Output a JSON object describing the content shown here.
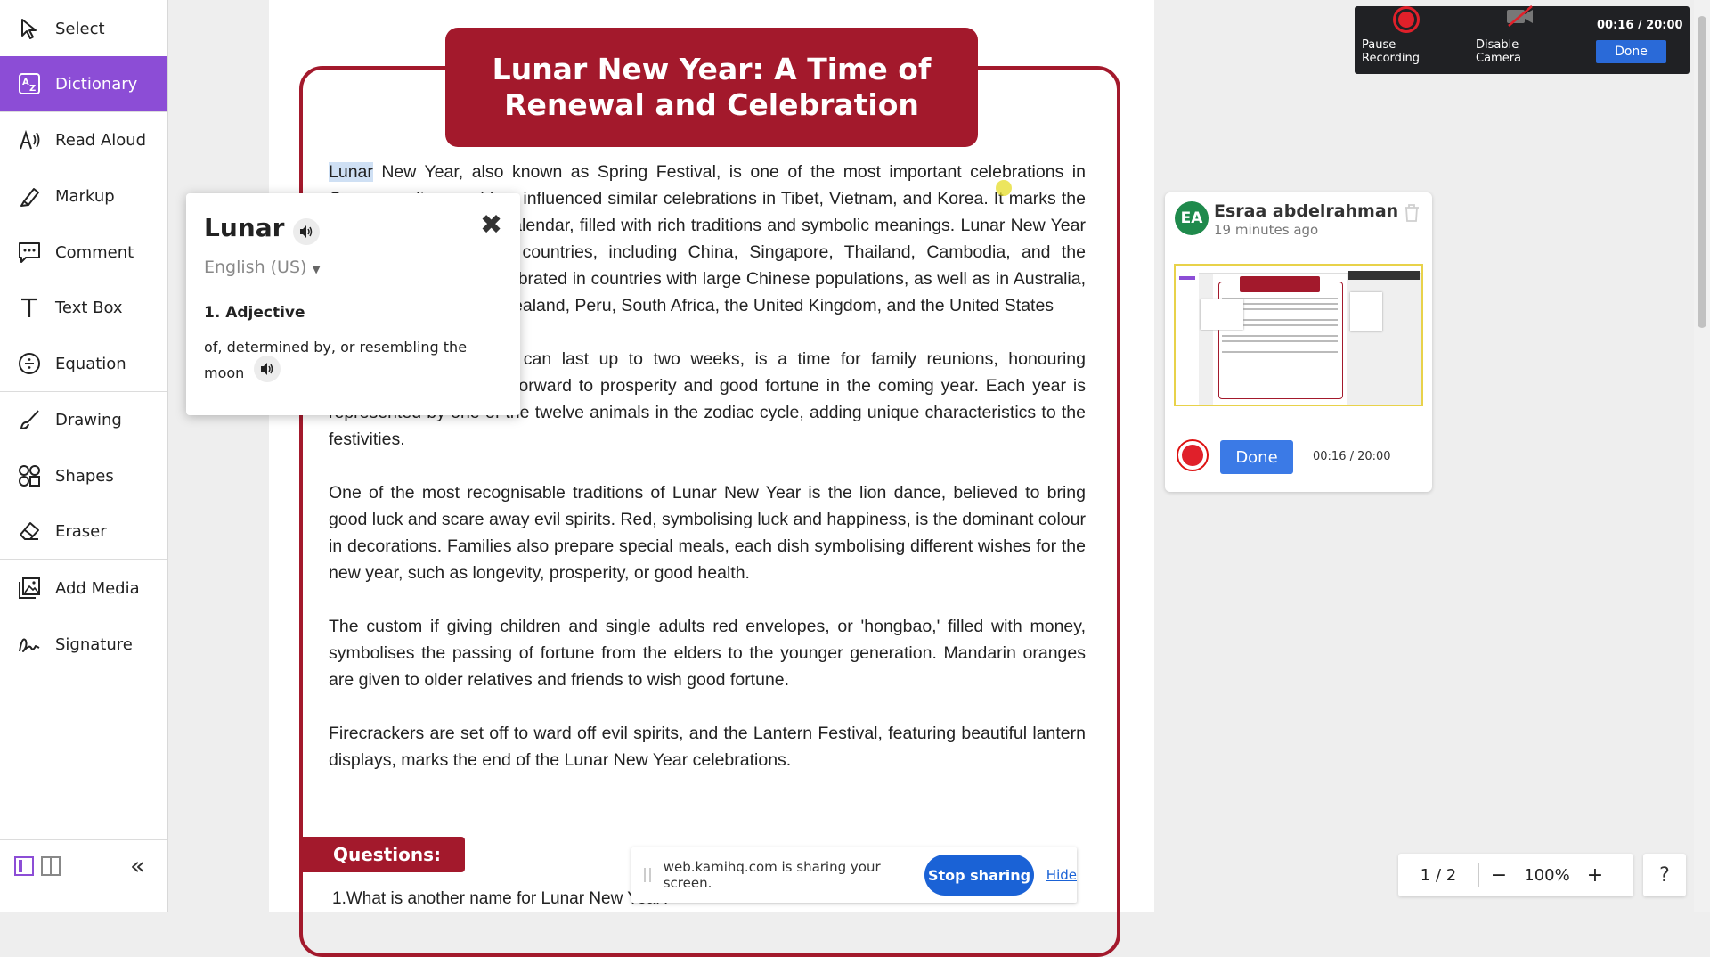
{
  "sidebar": {
    "tools": [
      {
        "label": "Select",
        "icon": "cursor-icon",
        "active": false
      },
      {
        "label": "Dictionary",
        "icon": "dictionary-icon",
        "active": true
      },
      {
        "label": "Read Aloud",
        "icon": "read-aloud-icon",
        "active": false
      },
      {
        "label": "Markup",
        "icon": "highlighter-icon",
        "active": false
      },
      {
        "label": "Comment",
        "icon": "comment-icon",
        "active": false
      },
      {
        "label": "Text Box",
        "icon": "text-icon",
        "active": false
      },
      {
        "label": "Equation",
        "icon": "equation-icon",
        "active": false
      },
      {
        "label": "Drawing",
        "icon": "brush-icon",
        "active": false
      },
      {
        "label": "Shapes",
        "icon": "shapes-icon",
        "active": false
      },
      {
        "label": "Eraser",
        "icon": "eraser-icon",
        "active": false
      },
      {
        "label": "Add Media",
        "icon": "media-icon",
        "active": false
      },
      {
        "label": "Signature",
        "icon": "signature-icon",
        "active": false
      }
    ],
    "accent_color": "#8c4dd6"
  },
  "document": {
    "title": "Lunar New Year: A Time of Renewal and Celebration",
    "highlighted_word": "Lunar",
    "p1_rest": " New Year, also known as Spring Festival, is one of the most important celebrations in Chinese culture and has influenced similar celebrations in Tibet, Vietnam, and Korea. It marks the beginning of the lunar calendar, filled with rich traditions and symbolic meanings. Lunar New Year is celebrated in many countries, including China, Singapore, Thailand, Cambodia, and the Philippines. It's also celebrated in countries with large Chinese populations, as well as in Australia, Canada, France, New Zealand, Peru, South Africa, the United Kingdom, and the United States",
    "p2": "The celebration, which can last up to two weeks, is a time for family reunions, honouring ancestors, and looking forward to prosperity and good fortune in the coming year. Each year is represented by one of the twelve animals in the zodiac cycle, adding unique characteristics to the festivities.",
    "p3": "One of the most recognisable traditions of Lunar New Year is the lion dance, believed to bring good luck and scare away evil spirits. Red, symbolising luck and happiness, is the dominant colour in decorations. Families also prepare special meals, each dish symbolising different wishes for the new year, such as longevity, prosperity, or good health.",
    "p4": "The custom if giving children and single adults red envelopes, or 'hongbao,' filled with money, symbolises the passing of fortune from the elders to the younger generation. Mandarin oranges are given to older relatives and friends to wish good fortune.",
    "p5": "Firecrackers are set off to ward off evil spirits, and the Lantern Festival, featuring beautiful lantern displays, marks the end of the Lunar New Year celebrations.",
    "questions_label": "Questions:",
    "question1": "1.What is another name for Lunar New Year?",
    "theme_color": "#a3192c"
  },
  "dictionary": {
    "word": "Lunar",
    "language": "English (US)",
    "part_of_speech": "1. Adjective",
    "definition": "of, determined by, or resembling the moon"
  },
  "recording": {
    "pause_label": "Pause Recording",
    "camera_label": "Disable Camera",
    "timer": "00:16 / 20:00",
    "done_label": "Done"
  },
  "comment_card": {
    "initials": "EA",
    "name": "Esraa abdelrahman",
    "time": "19 minutes ago",
    "done_label": "Done",
    "timer": "00:16 / 20:00"
  },
  "screen_share": {
    "message": "web.kamihq.com is sharing your screen.",
    "stop_label": "Stop sharing",
    "hide_label": "Hide"
  },
  "zoom": {
    "page": "1 / 2",
    "minus": "−",
    "percent": "100%",
    "plus": "+"
  },
  "help_label": "?"
}
